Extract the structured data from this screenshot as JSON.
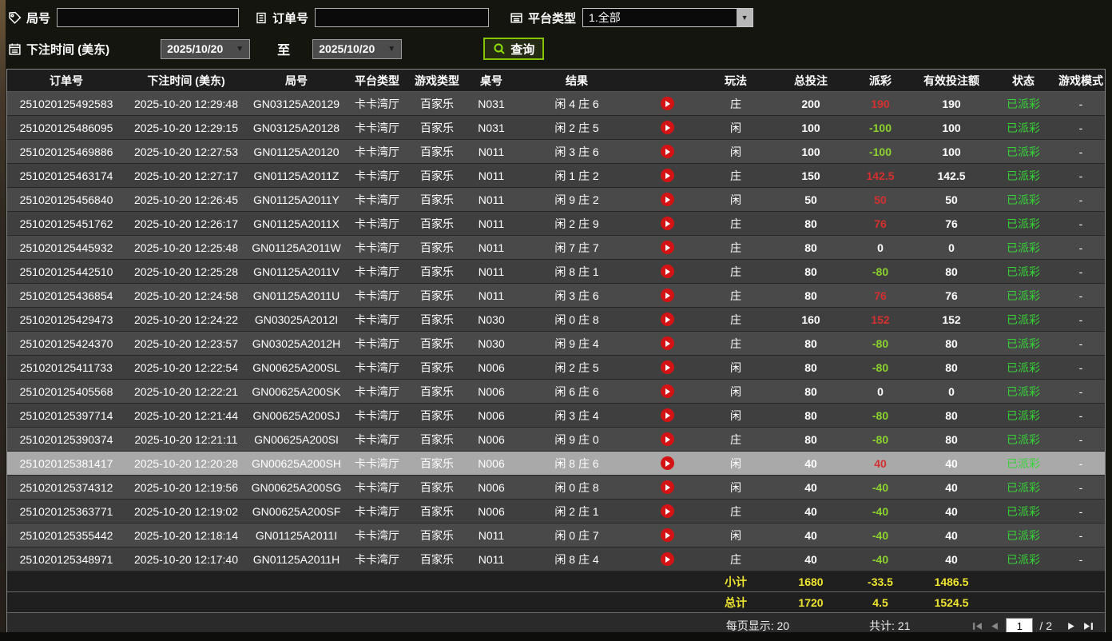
{
  "filters": {
    "round": {
      "label": "局号",
      "value": ""
    },
    "order": {
      "label": "订单号",
      "value": ""
    },
    "platform": {
      "label": "平台类型",
      "value": "1.全部"
    },
    "bet_time": {
      "label": "下注时间 (美东)",
      "from": "2025/10/20",
      "to_word": "至",
      "to": "2025/10/20"
    },
    "query_label": "查询"
  },
  "table": {
    "columns": [
      "订单号",
      "下注时间 (美东)",
      "局号",
      "平台类型",
      "游戏类型",
      "桌号",
      "结果",
      "",
      "玩法",
      "总投注",
      "派彩",
      "有效投注额",
      "状态",
      "游戏模式"
    ],
    "rows": [
      {
        "order": "251020125492583",
        "time": "2025-10-20 12:29:48",
        "round": "GN03125A20129",
        "platform": "卡卡湾厅",
        "game": "百家乐",
        "table": "N031",
        "result": "闲 4 庄 6",
        "bet": "庄",
        "total": "200",
        "payout": "190",
        "payout_class": "pos",
        "valid": "190",
        "status": "已派彩",
        "mode": "-",
        "selected": false
      },
      {
        "order": "251020125486095",
        "time": "2025-10-20 12:29:15",
        "round": "GN03125A20128",
        "platform": "卡卡湾厅",
        "game": "百家乐",
        "table": "N031",
        "result": "闲 2 庄 5",
        "bet": "闲",
        "total": "100",
        "payout": "-100",
        "payout_class": "neg",
        "valid": "100",
        "status": "已派彩",
        "mode": "-",
        "selected": false
      },
      {
        "order": "251020125469886",
        "time": "2025-10-20 12:27:53",
        "round": "GN01125A20120",
        "platform": "卡卡湾厅",
        "game": "百家乐",
        "table": "N011",
        "result": "闲 3 庄 6",
        "bet": "闲",
        "total": "100",
        "payout": "-100",
        "payout_class": "neg",
        "valid": "100",
        "status": "已派彩",
        "mode": "-",
        "selected": false
      },
      {
        "order": "251020125463174",
        "time": "2025-10-20 12:27:17",
        "round": "GN01125A2011Z",
        "platform": "卡卡湾厅",
        "game": "百家乐",
        "table": "N011",
        "result": "闲 1 庄 2",
        "bet": "庄",
        "total": "150",
        "payout": "142.5",
        "payout_class": "pos",
        "valid": "142.5",
        "status": "已派彩",
        "mode": "-",
        "selected": false
      },
      {
        "order": "251020125456840",
        "time": "2025-10-20 12:26:45",
        "round": "GN01125A2011Y",
        "platform": "卡卡湾厅",
        "game": "百家乐",
        "table": "N011",
        "result": "闲 9 庄 2",
        "bet": "闲",
        "total": "50",
        "payout": "50",
        "payout_class": "pos",
        "valid": "50",
        "status": "已派彩",
        "mode": "-",
        "selected": false
      },
      {
        "order": "251020125451762",
        "time": "2025-10-20 12:26:17",
        "round": "GN01125A2011X",
        "platform": "卡卡湾厅",
        "game": "百家乐",
        "table": "N011",
        "result": "闲 2 庄 9",
        "bet": "庄",
        "total": "80",
        "payout": "76",
        "payout_class": "pos",
        "valid": "76",
        "status": "已派彩",
        "mode": "-",
        "selected": false
      },
      {
        "order": "251020125445932",
        "time": "2025-10-20 12:25:48",
        "round": "GN01125A2011W",
        "platform": "卡卡湾厅",
        "game": "百家乐",
        "table": "N011",
        "result": "闲 7 庄 7",
        "bet": "庄",
        "total": "80",
        "payout": "0",
        "payout_class": "zero",
        "valid": "0",
        "status": "已派彩",
        "mode": "-",
        "selected": false
      },
      {
        "order": "251020125442510",
        "time": "2025-10-20 12:25:28",
        "round": "GN01125A2011V",
        "platform": "卡卡湾厅",
        "game": "百家乐",
        "table": "N011",
        "result": "闲 8 庄 1",
        "bet": "庄",
        "total": "80",
        "payout": "-80",
        "payout_class": "neg",
        "valid": "80",
        "status": "已派彩",
        "mode": "-",
        "selected": false
      },
      {
        "order": "251020125436854",
        "time": "2025-10-20 12:24:58",
        "round": "GN01125A2011U",
        "platform": "卡卡湾厅",
        "game": "百家乐",
        "table": "N011",
        "result": "闲 3 庄 6",
        "bet": "庄",
        "total": "80",
        "payout": "76",
        "payout_class": "pos",
        "valid": "76",
        "status": "已派彩",
        "mode": "-",
        "selected": false
      },
      {
        "order": "251020125429473",
        "time": "2025-10-20 12:24:22",
        "round": "GN03025A2012I",
        "platform": "卡卡湾厅",
        "game": "百家乐",
        "table": "N030",
        "result": "闲 0 庄 8",
        "bet": "庄",
        "total": "160",
        "payout": "152",
        "payout_class": "pos",
        "valid": "152",
        "status": "已派彩",
        "mode": "-",
        "selected": false
      },
      {
        "order": "251020125424370",
        "time": "2025-10-20 12:23:57",
        "round": "GN03025A2012H",
        "platform": "卡卡湾厅",
        "game": "百家乐",
        "table": "N030",
        "result": "闲 9 庄 4",
        "bet": "庄",
        "total": "80",
        "payout": "-80",
        "payout_class": "neg",
        "valid": "80",
        "status": "已派彩",
        "mode": "-",
        "selected": false
      },
      {
        "order": "251020125411733",
        "time": "2025-10-20 12:22:54",
        "round": "GN00625A200SL",
        "platform": "卡卡湾厅",
        "game": "百家乐",
        "table": "N006",
        "result": "闲 2 庄 5",
        "bet": "闲",
        "total": "80",
        "payout": "-80",
        "payout_class": "neg",
        "valid": "80",
        "status": "已派彩",
        "mode": "-",
        "selected": false
      },
      {
        "order": "251020125405568",
        "time": "2025-10-20 12:22:21",
        "round": "GN00625A200SK",
        "platform": "卡卡湾厅",
        "game": "百家乐",
        "table": "N006",
        "result": "闲 6 庄 6",
        "bet": "闲",
        "total": "80",
        "payout": "0",
        "payout_class": "zero",
        "valid": "0",
        "status": "已派彩",
        "mode": "-",
        "selected": false
      },
      {
        "order": "251020125397714",
        "time": "2025-10-20 12:21:44",
        "round": "GN00625A200SJ",
        "platform": "卡卡湾厅",
        "game": "百家乐",
        "table": "N006",
        "result": "闲 3 庄 4",
        "bet": "闲",
        "total": "80",
        "payout": "-80",
        "payout_class": "neg",
        "valid": "80",
        "status": "已派彩",
        "mode": "-",
        "selected": false
      },
      {
        "order": "251020125390374",
        "time": "2025-10-20 12:21:11",
        "round": "GN00625A200SI",
        "platform": "卡卡湾厅",
        "game": "百家乐",
        "table": "N006",
        "result": "闲 9 庄 0",
        "bet": "庄",
        "total": "80",
        "payout": "-80",
        "payout_class": "neg",
        "valid": "80",
        "status": "已派彩",
        "mode": "-",
        "selected": false
      },
      {
        "order": "251020125381417",
        "time": "2025-10-20 12:20:28",
        "round": "GN00625A200SH",
        "platform": "卡卡湾厅",
        "game": "百家乐",
        "table": "N006",
        "result": "闲 8 庄 6",
        "bet": "闲",
        "total": "40",
        "payout": "40",
        "payout_class": "pos",
        "valid": "40",
        "status": "已派彩",
        "mode": "-",
        "selected": true
      },
      {
        "order": "251020125374312",
        "time": "2025-10-20 12:19:56",
        "round": "GN00625A200SG",
        "platform": "卡卡湾厅",
        "game": "百家乐",
        "table": "N006",
        "result": "闲 0 庄 8",
        "bet": "闲",
        "total": "40",
        "payout": "-40",
        "payout_class": "neg",
        "valid": "40",
        "status": "已派彩",
        "mode": "-",
        "selected": false
      },
      {
        "order": "251020125363771",
        "time": "2025-10-20 12:19:02",
        "round": "GN00625A200SF",
        "platform": "卡卡湾厅",
        "game": "百家乐",
        "table": "N006",
        "result": "闲 2 庄 1",
        "bet": "庄",
        "total": "40",
        "payout": "-40",
        "payout_class": "neg",
        "valid": "40",
        "status": "已派彩",
        "mode": "-",
        "selected": false
      },
      {
        "order": "251020125355442",
        "time": "2025-10-20 12:18:14",
        "round": "GN01125A2011I",
        "platform": "卡卡湾厅",
        "game": "百家乐",
        "table": "N011",
        "result": "闲 0 庄 7",
        "bet": "闲",
        "total": "40",
        "payout": "-40",
        "payout_class": "neg",
        "valid": "40",
        "status": "已派彩",
        "mode": "-",
        "selected": false
      },
      {
        "order": "251020125348971",
        "time": "2025-10-20 12:17:40",
        "round": "GN01125A2011H",
        "platform": "卡卡湾厅",
        "game": "百家乐",
        "table": "N011",
        "result": "闲 8 庄 4",
        "bet": "庄",
        "total": "40",
        "payout": "-40",
        "payout_class": "neg",
        "valid": "40",
        "status": "已派彩",
        "mode": "-",
        "selected": false
      }
    ]
  },
  "summary": {
    "subtotal_label": "小计",
    "subtotal_total": "1680",
    "subtotal_payout": "-33.5",
    "subtotal_valid": "1486.5",
    "total_label": "总计",
    "total_total": "1720",
    "total_payout": "4.5",
    "total_valid": "1524.5"
  },
  "pagination": {
    "per_page": "每页显示: 20",
    "total_count": "共计: 21",
    "page": "1",
    "separator": "/",
    "total_pages": "2"
  },
  "colors": {
    "payout_positive": "#d43030",
    "payout_negative": "#8cd32e",
    "status_paid": "#35d435",
    "summary_yellow": "#f0e52e",
    "query_border": "#85c500",
    "play_icon": "#d41414",
    "selected_row": "#a9a9a9"
  }
}
